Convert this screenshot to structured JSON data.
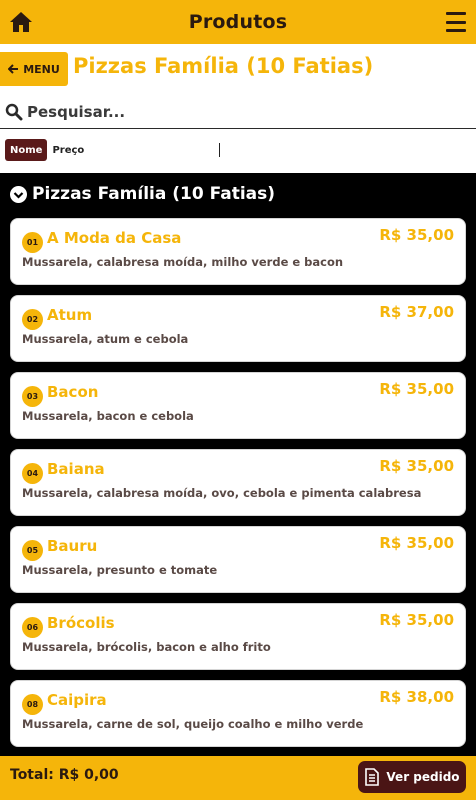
{
  "header": {
    "title": "Produtos"
  },
  "category": {
    "menu_label": "MENU",
    "title": "Pizzas Família (10 Fatias)"
  },
  "search": {
    "placeholder": "Pesquisar..."
  },
  "sort": {
    "active": "Nome",
    "other": "Preço"
  },
  "section": {
    "title": "Pizzas Família (10 Fatias)"
  },
  "products": [
    {
      "num": "01",
      "name": "A Moda da Casa",
      "price": "R$ 35,00",
      "desc": "Mussarela, calabresa moída, milho verde e bacon"
    },
    {
      "num": "02",
      "name": "Atum",
      "price": "R$ 37,00",
      "desc": "Mussarela, atum e cebola"
    },
    {
      "num": "03",
      "name": "Bacon",
      "price": "R$ 35,00",
      "desc": "Mussarela, bacon e cebola"
    },
    {
      "num": "04",
      "name": "Baiana",
      "price": "R$ 35,00",
      "desc": "Mussarela, calabresa moída, ovo, cebola e pimenta calabresa"
    },
    {
      "num": "05",
      "name": "Bauru",
      "price": "R$ 35,00",
      "desc": "Mussarela, presunto e tomate"
    },
    {
      "num": "06",
      "name": "Brócolis",
      "price": "R$ 35,00",
      "desc": "Mussarela, brócolis, bacon e alho frito"
    },
    {
      "num": "08",
      "name": "Caipira",
      "price": "R$ 38,00",
      "desc": "Mussarela, carne de sol, queijo coalho e milho verde"
    }
  ],
  "footer": {
    "total": "Total: R$ 0,00",
    "button": "Ver pedido"
  },
  "colors": {
    "accent": "#f5b50a",
    "dark": "#2b1a10",
    "button_bg": "#4a1515",
    "sort_pill": "#5a1a1a"
  }
}
